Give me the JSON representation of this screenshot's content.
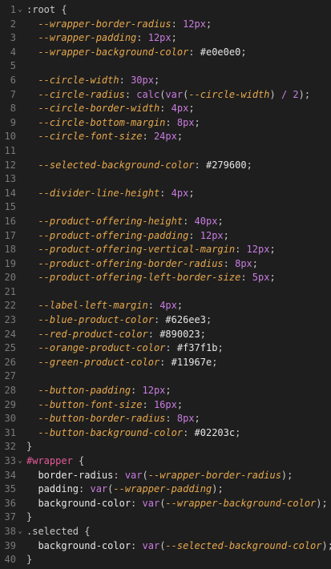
{
  "editor": {
    "lines": [
      {
        "n": "1",
        "fold": true,
        "tokens": [
          [
            ":root",
            "selector"
          ],
          [
            " {",
            "punct"
          ]
        ]
      },
      {
        "n": "2",
        "tokens": [
          [
            "  ",
            "punct"
          ],
          [
            "--wrapper-border-radius",
            "prop"
          ],
          [
            ": ",
            "punct"
          ],
          [
            "12px",
            "num"
          ],
          [
            ";",
            "punct"
          ]
        ]
      },
      {
        "n": "3",
        "tokens": [
          [
            "  ",
            "punct"
          ],
          [
            "--wrapper-padding",
            "prop"
          ],
          [
            ": ",
            "punct"
          ],
          [
            "12px",
            "num"
          ],
          [
            ";",
            "punct"
          ]
        ]
      },
      {
        "n": "4",
        "tokens": [
          [
            "  ",
            "punct"
          ],
          [
            "--wrapper-background-color",
            "prop"
          ],
          [
            ": ",
            "punct"
          ],
          [
            "#e0e0e0",
            "color"
          ],
          [
            ";",
            "punct"
          ]
        ]
      },
      {
        "n": "5",
        "tokens": []
      },
      {
        "n": "6",
        "tokens": [
          [
            "  ",
            "punct"
          ],
          [
            "--circle-width",
            "prop"
          ],
          [
            ": ",
            "punct"
          ],
          [
            "30px",
            "num"
          ],
          [
            ";",
            "punct"
          ]
        ]
      },
      {
        "n": "7",
        "tokens": [
          [
            "  ",
            "punct"
          ],
          [
            "--circle-radius",
            "prop"
          ],
          [
            ": ",
            "punct"
          ],
          [
            "calc",
            "fn"
          ],
          [
            "(",
            "punct"
          ],
          [
            "var",
            "fn"
          ],
          [
            "(",
            "punct"
          ],
          [
            "--circle-width",
            "var"
          ],
          [
            ") ",
            "punct"
          ],
          [
            "/",
            "op"
          ],
          [
            " ",
            "punct"
          ],
          [
            "2",
            "num"
          ],
          [
            ");",
            "punct"
          ]
        ]
      },
      {
        "n": "8",
        "tokens": [
          [
            "  ",
            "punct"
          ],
          [
            "--circle-border-width",
            "prop"
          ],
          [
            ": ",
            "punct"
          ],
          [
            "4px",
            "num"
          ],
          [
            ";",
            "punct"
          ]
        ]
      },
      {
        "n": "9",
        "tokens": [
          [
            "  ",
            "punct"
          ],
          [
            "--circle-bottom-margin",
            "prop"
          ],
          [
            ": ",
            "punct"
          ],
          [
            "8px",
            "num"
          ],
          [
            ";",
            "punct"
          ]
        ]
      },
      {
        "n": "10",
        "tokens": [
          [
            "  ",
            "punct"
          ],
          [
            "--circle-font-size",
            "prop"
          ],
          [
            ": ",
            "punct"
          ],
          [
            "24px",
            "num"
          ],
          [
            ";",
            "punct"
          ]
        ]
      },
      {
        "n": "11",
        "tokens": []
      },
      {
        "n": "12",
        "tokens": [
          [
            "  ",
            "punct"
          ],
          [
            "--selected-background-color",
            "prop"
          ],
          [
            ": ",
            "punct"
          ],
          [
            "#279600",
            "color"
          ],
          [
            ";",
            "punct"
          ]
        ]
      },
      {
        "n": "13",
        "tokens": []
      },
      {
        "n": "14",
        "tokens": [
          [
            "  ",
            "punct"
          ],
          [
            "--divider-line-height",
            "prop"
          ],
          [
            ": ",
            "punct"
          ],
          [
            "4px",
            "num"
          ],
          [
            ";",
            "punct"
          ]
        ]
      },
      {
        "n": "15",
        "tokens": []
      },
      {
        "n": "16",
        "tokens": [
          [
            "  ",
            "punct"
          ],
          [
            "--product-offering-height",
            "prop"
          ],
          [
            ": ",
            "punct"
          ],
          [
            "40px",
            "num"
          ],
          [
            ";",
            "punct"
          ]
        ]
      },
      {
        "n": "17",
        "tokens": [
          [
            "  ",
            "punct"
          ],
          [
            "--product-offering-padding",
            "prop"
          ],
          [
            ": ",
            "punct"
          ],
          [
            "12px",
            "num"
          ],
          [
            ";",
            "punct"
          ]
        ]
      },
      {
        "n": "18",
        "tokens": [
          [
            "  ",
            "punct"
          ],
          [
            "--product-offering-vertical-margin",
            "prop"
          ],
          [
            ": ",
            "punct"
          ],
          [
            "12px",
            "num"
          ],
          [
            ";",
            "punct"
          ]
        ]
      },
      {
        "n": "19",
        "tokens": [
          [
            "  ",
            "punct"
          ],
          [
            "--product-offering-border-radius",
            "prop"
          ],
          [
            ": ",
            "punct"
          ],
          [
            "8px",
            "num"
          ],
          [
            ";",
            "punct"
          ]
        ]
      },
      {
        "n": "20",
        "tokens": [
          [
            "  ",
            "punct"
          ],
          [
            "--product-offering-left-border-size",
            "prop"
          ],
          [
            ": ",
            "punct"
          ],
          [
            "5px",
            "num"
          ],
          [
            ";",
            "punct"
          ]
        ]
      },
      {
        "n": "21",
        "tokens": []
      },
      {
        "n": "22",
        "tokens": [
          [
            "  ",
            "punct"
          ],
          [
            "--label-left-margin",
            "prop"
          ],
          [
            ": ",
            "punct"
          ],
          [
            "4px",
            "num"
          ],
          [
            ";",
            "punct"
          ]
        ]
      },
      {
        "n": "23",
        "tokens": [
          [
            "  ",
            "punct"
          ],
          [
            "--blue-product-color",
            "prop"
          ],
          [
            ": ",
            "punct"
          ],
          [
            "#626ee3",
            "color"
          ],
          [
            ";",
            "punct"
          ]
        ]
      },
      {
        "n": "24",
        "tokens": [
          [
            "  ",
            "punct"
          ],
          [
            "--red-product-color",
            "prop"
          ],
          [
            ": ",
            "punct"
          ],
          [
            "#890023",
            "color"
          ],
          [
            ";",
            "punct"
          ]
        ]
      },
      {
        "n": "25",
        "tokens": [
          [
            "  ",
            "punct"
          ],
          [
            "--orange-product-color",
            "prop"
          ],
          [
            ": ",
            "punct"
          ],
          [
            "#f37f1b",
            "color"
          ],
          [
            ";",
            "punct"
          ]
        ]
      },
      {
        "n": "26",
        "tokens": [
          [
            "  ",
            "punct"
          ],
          [
            "--green-product-color",
            "prop"
          ],
          [
            ": ",
            "punct"
          ],
          [
            "#11967e",
            "color"
          ],
          [
            ";",
            "punct"
          ]
        ]
      },
      {
        "n": "27",
        "tokens": []
      },
      {
        "n": "28",
        "tokens": [
          [
            "  ",
            "punct"
          ],
          [
            "--button-padding",
            "prop"
          ],
          [
            ": ",
            "punct"
          ],
          [
            "12px",
            "num"
          ],
          [
            ";",
            "punct"
          ]
        ]
      },
      {
        "n": "29",
        "tokens": [
          [
            "  ",
            "punct"
          ],
          [
            "--button-font-size",
            "prop"
          ],
          [
            ": ",
            "punct"
          ],
          [
            "16px",
            "num"
          ],
          [
            ";",
            "punct"
          ]
        ]
      },
      {
        "n": "30",
        "tokens": [
          [
            "  ",
            "punct"
          ],
          [
            "--button-border-radius",
            "prop"
          ],
          [
            ": ",
            "punct"
          ],
          [
            "8px",
            "num"
          ],
          [
            ";",
            "punct"
          ]
        ]
      },
      {
        "n": "31",
        "tokens": [
          [
            "  ",
            "punct"
          ],
          [
            "--button-background-color",
            "prop"
          ],
          [
            ": ",
            "punct"
          ],
          [
            "#02203c",
            "color"
          ],
          [
            ";",
            "punct"
          ]
        ]
      },
      {
        "n": "32",
        "tokens": [
          [
            "}",
            "punct"
          ]
        ]
      },
      {
        "n": "33",
        "fold": true,
        "tokens": [
          [
            "#wrapper",
            "id"
          ],
          [
            " {",
            "punct"
          ]
        ]
      },
      {
        "n": "34",
        "tokens": [
          [
            "  ",
            "punct"
          ],
          [
            "border-radius",
            "attr"
          ],
          [
            ": ",
            "punct"
          ],
          [
            "var",
            "fn"
          ],
          [
            "(",
            "punct"
          ],
          [
            "--wrapper-border-radius",
            "var"
          ],
          [
            ");",
            "punct"
          ]
        ]
      },
      {
        "n": "35",
        "tokens": [
          [
            "  ",
            "punct"
          ],
          [
            "padding",
            "attr"
          ],
          [
            ": ",
            "punct"
          ],
          [
            "var",
            "fn"
          ],
          [
            "(",
            "punct"
          ],
          [
            "--wrapper-padding",
            "var"
          ],
          [
            ");",
            "punct"
          ]
        ]
      },
      {
        "n": "36",
        "tokens": [
          [
            "  ",
            "punct"
          ],
          [
            "background-color",
            "attr"
          ],
          [
            ": ",
            "punct"
          ],
          [
            "var",
            "fn"
          ],
          [
            "(",
            "punct"
          ],
          [
            "--wrapper-background-color",
            "var"
          ],
          [
            ");",
            "punct"
          ]
        ]
      },
      {
        "n": "37",
        "tokens": [
          [
            "}",
            "punct"
          ]
        ]
      },
      {
        "n": "38",
        "fold": true,
        "tokens": [
          [
            ".selected",
            "class"
          ],
          [
            " {",
            "punct"
          ]
        ]
      },
      {
        "n": "39",
        "tokens": [
          [
            "  ",
            "punct"
          ],
          [
            "background-color",
            "attr"
          ],
          [
            ": ",
            "punct"
          ],
          [
            "var",
            "fn"
          ],
          [
            "(",
            "punct"
          ],
          [
            "--selected-background-color",
            "var"
          ],
          [
            ");",
            "punct"
          ]
        ]
      },
      {
        "n": "40",
        "tokens": [
          [
            "}",
            "punct"
          ]
        ]
      }
    ],
    "fold_glyph": "⌄"
  }
}
